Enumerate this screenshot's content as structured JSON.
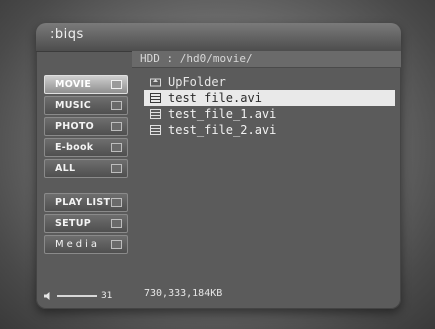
{
  "app": {
    "logo": ":biqs"
  },
  "path": "HDD : /hd0/movie/",
  "sidebar": {
    "items": [
      {
        "label": "MOVIE",
        "icon": "movie-icon",
        "active": true
      },
      {
        "label": "MUSIC",
        "icon": "music-icon",
        "active": false
      },
      {
        "label": "PHOTO",
        "icon": "photo-icon",
        "active": false
      },
      {
        "label": "E-book",
        "icon": "ebook-icon",
        "active": false
      },
      {
        "label": "ALL",
        "icon": "all-icon",
        "active": false
      },
      {
        "label": "PLAY LIST",
        "icon": "playlist-icon",
        "active": false
      },
      {
        "label": "SETUP",
        "icon": "setup-icon",
        "active": false
      },
      {
        "label": "Media",
        "icon": "media-icon",
        "active": false
      }
    ]
  },
  "files": [
    {
      "name": "UpFolder",
      "type": "up-folder"
    },
    {
      "name": "test file.avi",
      "type": "video",
      "selected": true
    },
    {
      "name": "test_file_1.avi",
      "type": "video"
    },
    {
      "name": "test_file_2.avi",
      "type": "video"
    }
  ],
  "volume": {
    "level": "31"
  },
  "status": {
    "size": "730,333,184KB"
  }
}
